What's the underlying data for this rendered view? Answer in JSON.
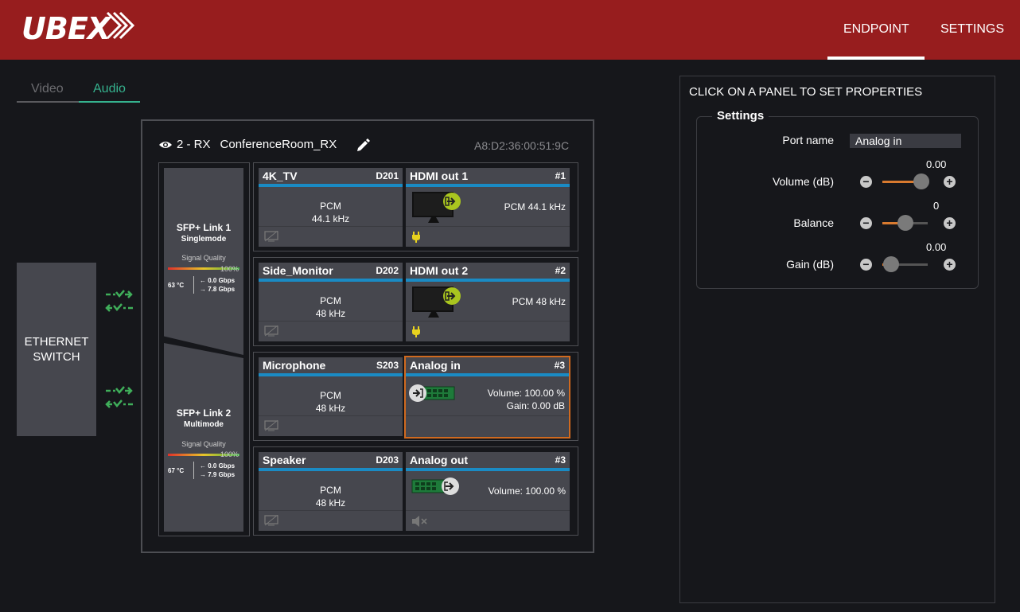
{
  "app": {
    "logo": "UBEX"
  },
  "nav": {
    "endpoint": "ENDPOINT",
    "settings": "SETTINGS"
  },
  "tabs": {
    "video": "Video",
    "audio": "Audio"
  },
  "ethernet": {
    "line1": "ETHERNET",
    "line2": "SWITCH"
  },
  "device": {
    "id": "2 - RX",
    "name": "ConferenceRoom_RX",
    "mac": "A8:D2:36:00:51:9C"
  },
  "sfp": [
    {
      "title": "SFP+ Link 1",
      "mode": "Singlemode",
      "quality_label": "Signal Quality",
      "quality": "100%",
      "temp": "63 °C",
      "rx": "0.0 Gbps",
      "tx": "7.8 Gbps"
    },
    {
      "title": "SFP+ Link 2",
      "mode": "Multimode",
      "quality_label": "Signal Quality",
      "quality": "100%",
      "temp": "67 °C",
      "rx": "0.0 Gbps",
      "tx": "7.9 Gbps"
    }
  ],
  "rows": [
    {
      "src_name": "4K_TV",
      "src_code": "D201",
      "src_fmt": "PCM",
      "src_rate": "44.1 kHz",
      "out_name": "HDMI out 1",
      "out_num": "#1",
      "out_info": "PCM 44.1 kHz"
    },
    {
      "src_name": "Side_Monitor",
      "src_code": "D202",
      "src_fmt": "PCM",
      "src_rate": "48 kHz",
      "out_name": "HDMI out 2",
      "out_num": "#2",
      "out_info": "PCM 48 kHz"
    },
    {
      "src_name": "Microphone",
      "src_code": "S203",
      "src_fmt": "PCM",
      "src_rate": "48 kHz",
      "out_name": "Analog in",
      "out_num": "#3",
      "out_info": "Volume: 100.00 %",
      "out_info2": "Gain: 0.00 dB"
    },
    {
      "src_name": "Speaker",
      "src_code": "D203",
      "src_fmt": "PCM",
      "src_rate": "48 kHz",
      "out_name": "Analog out",
      "out_num": "#3",
      "out_info": "Volume: 100.00 %"
    }
  ],
  "panel": {
    "title": "CLICK ON A PANEL TO SET PROPERTIES",
    "legend": "Settings",
    "port_name_label": "Port name",
    "port_name_value": "Analog in",
    "volume_label": "Volume (dB)",
    "volume_value": "0.00",
    "balance_label": "Balance",
    "balance_value": "0",
    "gain_label": "Gain (dB)",
    "gain_value": "0.00",
    "volume_level": 0.86,
    "balance_level": 0.5,
    "gain_level": 0.2
  },
  "colors": {
    "brand": "#971d1e",
    "accent": "#35b28e",
    "selected": "#d06a1f",
    "blue_bar": "#1a8bc4"
  }
}
